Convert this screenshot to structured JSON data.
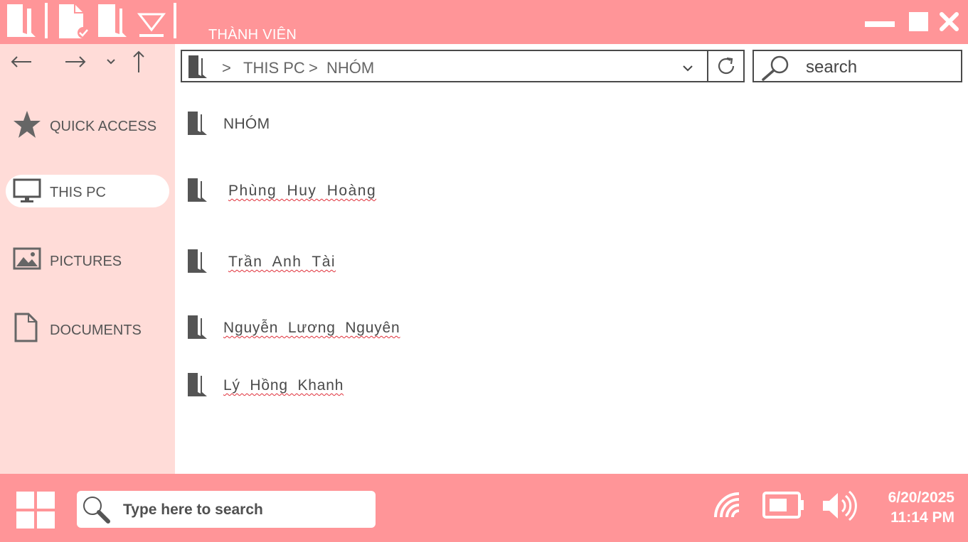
{
  "window": {
    "title": "THÀNH VIÊN",
    "toolbar_icons": [
      "folder-icon",
      "file-check-icon",
      "folder-icon",
      "download-icon"
    ],
    "controls": [
      "minimize-icon",
      "maximize-icon",
      "close-icon"
    ]
  },
  "nav": {
    "icons": [
      "back-arrow-icon",
      "forward-arrow-icon",
      "chevron-down-icon",
      "up-arrow-icon"
    ]
  },
  "address": {
    "separator": ">",
    "crumbs": [
      "THIS PC",
      "NHÓM"
    ]
  },
  "search": {
    "placeholder": "search"
  },
  "sidebar": {
    "items": [
      {
        "label": "QUICK ACCESS",
        "icon": "star-icon",
        "active": false
      },
      {
        "label": "THIS PC",
        "icon": "monitor-icon",
        "active": true
      },
      {
        "label": "PICTURES",
        "icon": "picture-icon",
        "active": false
      },
      {
        "label": "DOCUMENTS",
        "icon": "document-icon",
        "active": false
      }
    ]
  },
  "files": [
    {
      "name": "NHÓM"
    },
    {
      "name": "Phùng Huy Hoàng"
    },
    {
      "name": "Trần Anh Tài"
    },
    {
      "name": "Nguyễn Lương Nguyên"
    },
    {
      "name": "Lý Hồng Khanh"
    }
  ],
  "taskbar": {
    "search_placeholder": "Type here to search",
    "date": "6/20/2025",
    "time": "11:14 PM",
    "tray_icons": [
      "wifi-icon",
      "battery-icon",
      "volume-icon"
    ]
  },
  "colors": {
    "accent": "#ff9598",
    "sidebar": "#ffdcd8",
    "icon": "#555555"
  }
}
